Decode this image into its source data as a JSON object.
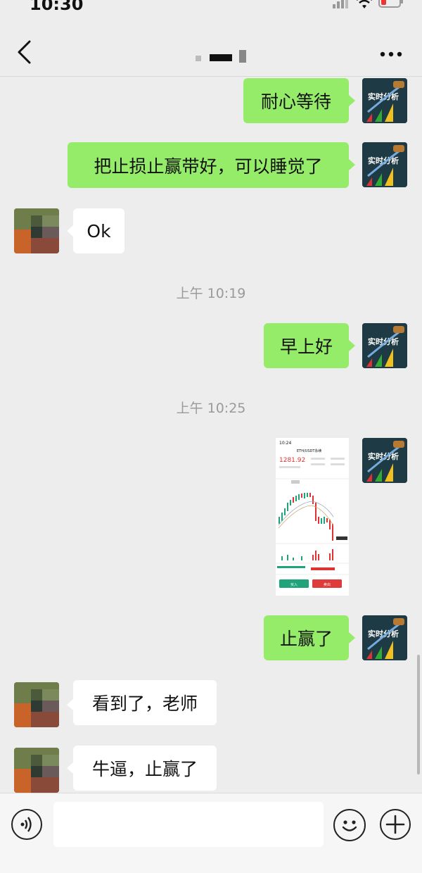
{
  "status_bar": {
    "time": "10:30"
  },
  "nav": {
    "back_icon": "chevron-left-icon",
    "more_icon": "more-horizontal-icon"
  },
  "chat": {
    "messages": [
      {
        "side": "me",
        "text": "耐心等待"
      },
      {
        "side": "me",
        "text": "把止损止赢带好，可以睡觉了"
      },
      {
        "side": "them",
        "text": "Ok"
      },
      {
        "side": "me",
        "text": "早上好"
      },
      {
        "side": "me",
        "type": "image",
        "image": {
          "time": "10:24",
          "pair": "ETH/USDT永续",
          "price": "1281.92",
          "buy": "买入",
          "sell": "卖出"
        }
      },
      {
        "side": "me",
        "text": "止赢了"
      },
      {
        "side": "them",
        "text": "看到了，老师"
      },
      {
        "side": "them",
        "text": "牛逼，止赢了"
      }
    ],
    "timestamps": [
      "上午 10:19",
      "上午 10:25"
    ],
    "teacher_avatar_text": "实时分析"
  },
  "input_bar": {
    "voice_icon": "voice-icon",
    "emoji_icon": "emoji-icon",
    "plus_icon": "plus-icon",
    "placeholder": ""
  },
  "colors": {
    "my_bubble": "#95ec69",
    "their_bubble": "#ffffff",
    "background": "#ededed",
    "timestamp": "#9a9a9a",
    "up_candle": "#1fa37a",
    "down_candle": "#e03b3b"
  }
}
